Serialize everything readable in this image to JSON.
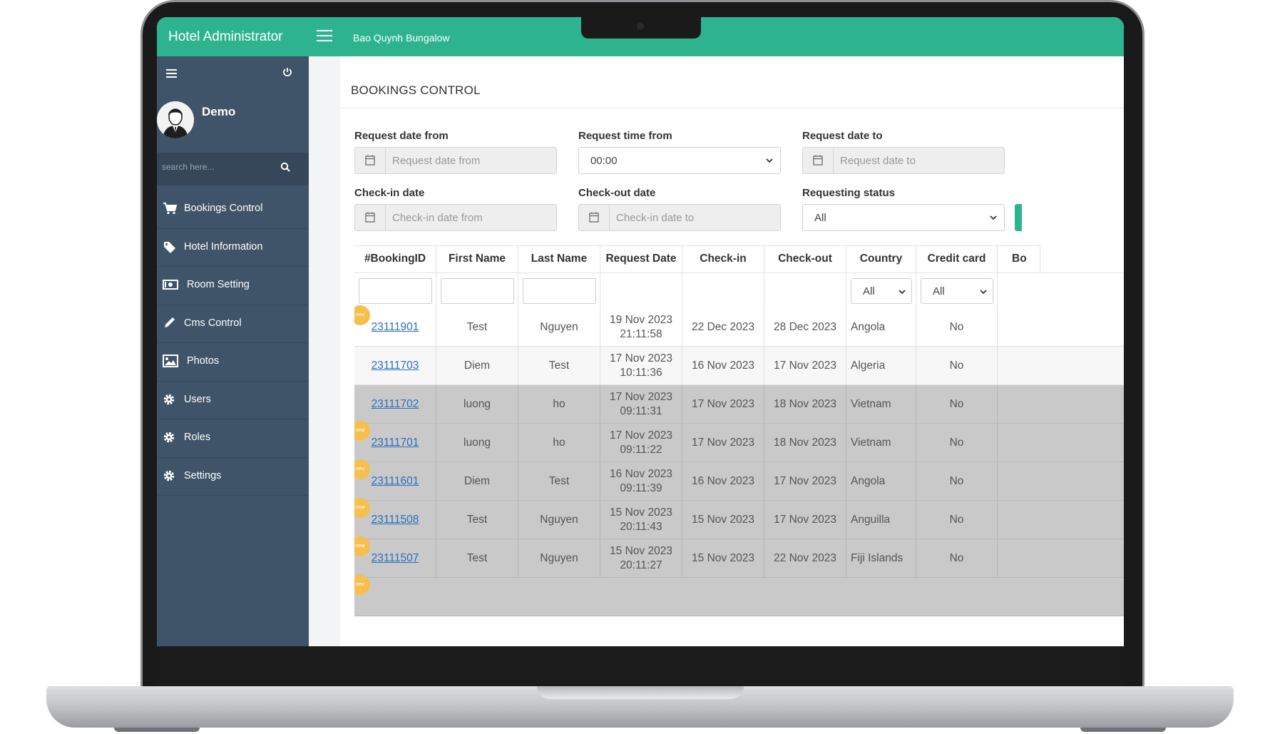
{
  "app": {
    "title": "Hotel Administrator",
    "hotel_name": "Bao Quynh Bungalow",
    "accent_color": "#2db48f",
    "sidebar_color": "#3f5468"
  },
  "sidebar": {
    "user_name": "Demo",
    "search_placeholder": "search here...",
    "items": [
      {
        "label": "Bookings Control",
        "icon": "cart-icon"
      },
      {
        "label": "Hotel Information",
        "icon": "tag-icon"
      },
      {
        "label": "Room Setting",
        "icon": "money-icon"
      },
      {
        "label": "Cms Control",
        "icon": "pencil-icon"
      },
      {
        "label": "Photos",
        "icon": "image-icon"
      },
      {
        "label": "Users",
        "icon": "gear-icon"
      },
      {
        "label": "Roles",
        "icon": "gear-icon"
      },
      {
        "label": "Settings",
        "icon": "gear-icon"
      }
    ]
  },
  "page": {
    "title": "BOOKINGS CONTROL"
  },
  "filters": {
    "request_date_from": {
      "label": "Request date from",
      "placeholder": "Request date from"
    },
    "request_time_from": {
      "label": "Request time from",
      "value": "00:00"
    },
    "request_date_to": {
      "label": "Request date to",
      "placeholder": "Request date to"
    },
    "checkin_date": {
      "label": "Check-in date",
      "placeholder": "Check-in date from"
    },
    "checkout_date": {
      "label": "Check-out date",
      "placeholder": "Check-in date to"
    },
    "requesting_status": {
      "label": "Requesting status",
      "value": "All"
    }
  },
  "table": {
    "headers": [
      "#BookingID",
      "First Name",
      "Last Name",
      "Request Date",
      "Check-in",
      "Check-out",
      "Country",
      "Credit card",
      "Bo"
    ],
    "country_filter": "All",
    "credit_filter": "All",
    "new_badge": "new",
    "rows": [
      {
        "id": "23111901",
        "first": "Test",
        "last": "Nguyen",
        "req1": "19 Nov 2023",
        "req2": "21:11:58",
        "checkin": "22 Dec 2023",
        "checkout": "28 Dec 2023",
        "country": "Angola",
        "credit": "No"
      },
      {
        "id": "23111703",
        "first": "Diem",
        "last": "Test",
        "req1": "17 Nov 2023",
        "req2": "10:11:36",
        "checkin": "16 Nov 2023",
        "checkout": "17 Nov 2023",
        "country": "Algeria",
        "credit": "No"
      },
      {
        "id": "23111702",
        "first": "luong",
        "last": "ho",
        "req1": "17 Nov 2023",
        "req2": "09:11:31",
        "checkin": "17 Nov 2023",
        "checkout": "18 Nov 2023",
        "country": "Vietnam",
        "credit": "No"
      },
      {
        "id": "23111701",
        "first": "luong",
        "last": "ho",
        "req1": "17 Nov 2023",
        "req2": "09:11:22",
        "checkin": "17 Nov 2023",
        "checkout": "18 Nov 2023",
        "country": "Vietnam",
        "credit": "No"
      },
      {
        "id": "23111601",
        "first": "Diem",
        "last": "Test",
        "req1": "16 Nov 2023",
        "req2": "09:11:39",
        "checkin": "16 Nov 2023",
        "checkout": "17 Nov 2023",
        "country": "Angola",
        "credit": "No"
      },
      {
        "id": "23111508",
        "first": "Test",
        "last": "Nguyen",
        "req1": "15 Nov 2023",
        "req2": "20:11:43",
        "checkin": "15 Nov 2023",
        "checkout": "17 Nov 2023",
        "country": "Anguilla",
        "credit": "No"
      },
      {
        "id": "23111507",
        "first": "Test",
        "last": "Nguyen",
        "req1": "15 Nov 2023",
        "req2": "20:11:27",
        "checkin": "15 Nov 2023",
        "checkout": "22 Nov 2023",
        "country": "Fiji Islands",
        "credit": "No"
      }
    ]
  }
}
